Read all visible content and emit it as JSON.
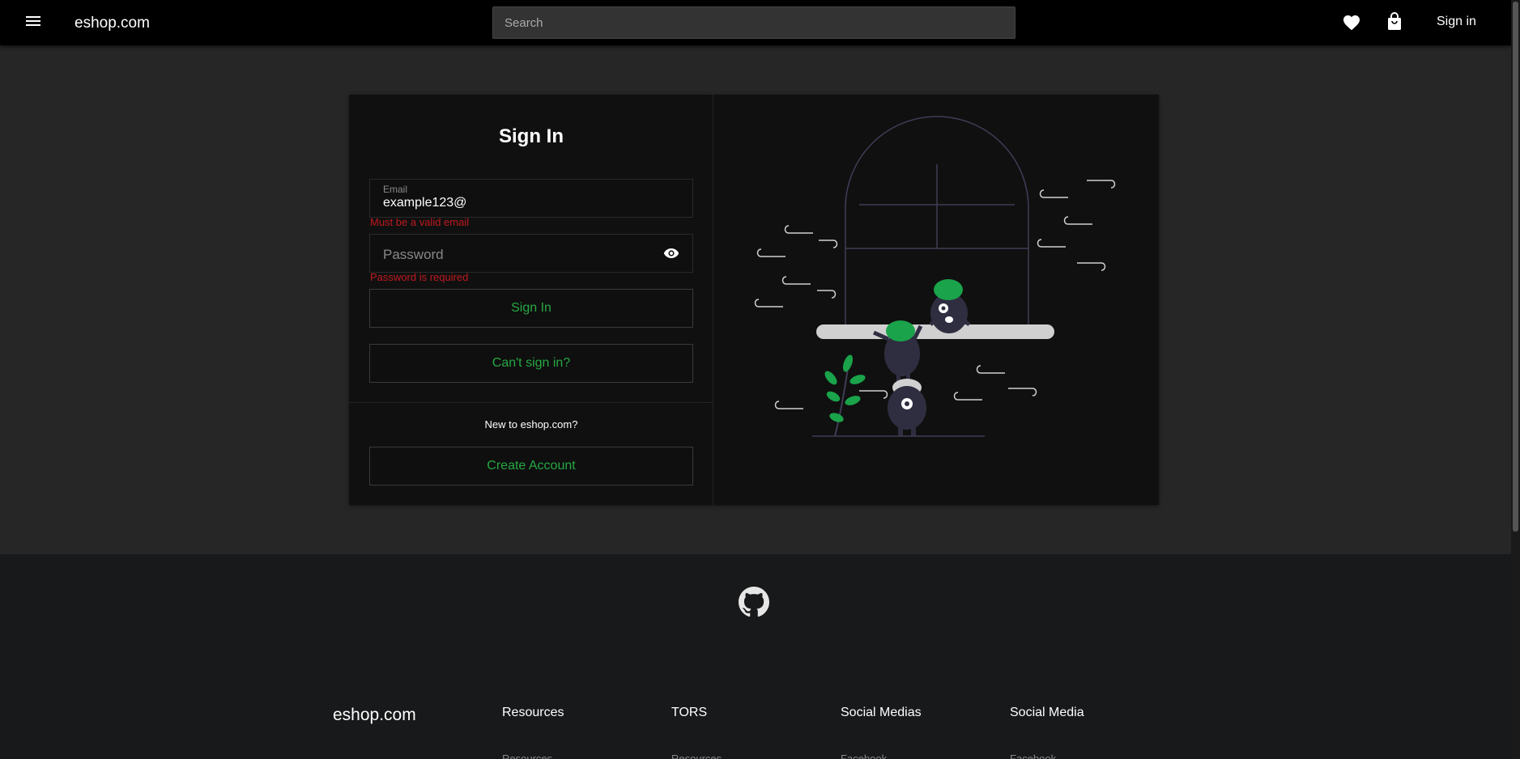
{
  "header": {
    "brand": "eshop.com",
    "search_placeholder": "Search",
    "signin_label": "Sign in"
  },
  "form": {
    "title": "Sign In",
    "email_label": "Email",
    "email_value": "example123@",
    "email_error": "Must be a valid email",
    "password_placeholder": "Password",
    "password_error": "Password is required",
    "signin_button": "Sign In",
    "cant_signin_button": "Can't sign in?",
    "new_to": "New to eshop.com?",
    "create_account_button": "Create Account"
  },
  "footer": {
    "brand": "eshop.com",
    "columns": [
      {
        "title": "Resources",
        "link": "Resources"
      },
      {
        "title": "TORS",
        "link": "Resources"
      },
      {
        "title": "Social Medias",
        "link": "Facebook"
      },
      {
        "title": "Social Media",
        "link": "Facebook"
      }
    ]
  },
  "colors": {
    "accent": "#27a844",
    "error": "#c0191f",
    "topbar": "#000000",
    "page_bg": "#262626",
    "card_bg": "#101010"
  },
  "icons": {
    "menu": "menu-icon",
    "heart": "heart-icon",
    "bag": "shopping-bag-icon",
    "eye": "eye-icon",
    "github": "github-icon"
  }
}
